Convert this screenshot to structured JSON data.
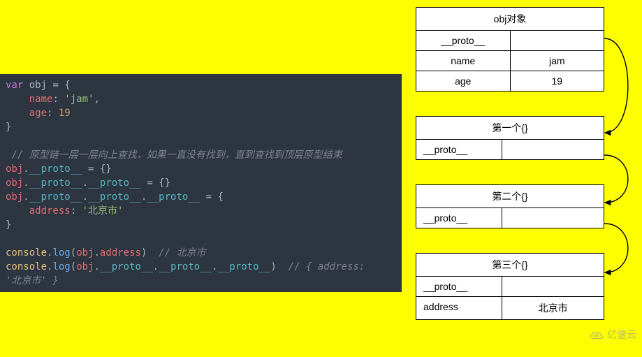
{
  "code": {
    "l1_kw": "var",
    "l1_var": " obj ",
    "l1_op": "= {",
    "l2_prop": "name",
    "l2_colon": ": ",
    "l2_val": "'jam'",
    "l2_comma": ",",
    "l3_prop": "age",
    "l3_colon": ": ",
    "l3_val": "19",
    "l4": "}",
    "l6_comment": "// 原型链一层一层向上查找，如果一直没有找到，直到查找到顶层原型结束",
    "l7_obj": "obj",
    "l7_dot": ".",
    "l7_proto": "__proto__",
    "l7_rest": " = {}",
    "l8_obj": "obj",
    "l8_d1": ".",
    "l8_p1": "__proto__",
    "l8_d2": ".",
    "l8_p2": "__proto__",
    "l8_rest": " = {}",
    "l9_obj": "obj",
    "l9_d1": ".",
    "l9_p1": "__proto__",
    "l9_d2": ".",
    "l9_p2": "__proto__",
    "l9_d3": ".",
    "l9_p3": "__proto__",
    "l9_rest": " = {",
    "l10_prop": "address",
    "l10_colon": ": ",
    "l10_val": "'北京市'",
    "l11": "}",
    "l13_console": "console",
    "l13_dot": ".",
    "l13_log": "log",
    "l13_open": "(",
    "l13_obj": "obj",
    "l13_d": ".",
    "l13_addr": "address",
    "l13_close": ")  ",
    "l13_comment": "// 北京市",
    "l14_console": "console",
    "l14_dot": ".",
    "l14_log": "log",
    "l14_open": "(",
    "l14_obj": "obj",
    "l14_d1": ".",
    "l14_p1": "__proto__",
    "l14_d2": ".",
    "l14_p2": "__proto__",
    "l14_d3": ".",
    "l14_p3": "__proto__",
    "l14_close": ")  ",
    "l14_comment": "// { address: ",
    "l15_comment": "'北京市' }"
  },
  "diagram": {
    "obj": {
      "title": "obj对象",
      "rows": [
        [
          "__proto__",
          ""
        ],
        [
          "name",
          "jam"
        ],
        [
          "age",
          "19"
        ]
      ]
    },
    "first": {
      "title": "第一个{}",
      "rows": [
        [
          "__proto__",
          ""
        ]
      ]
    },
    "second": {
      "title": "第二个{}",
      "rows": [
        [
          "__proto__",
          ""
        ]
      ]
    },
    "third": {
      "title": "第三个{}",
      "rows": [
        [
          "__proto__",
          ""
        ],
        [
          "address",
          "北京市"
        ]
      ]
    }
  },
  "watermark": "亿速云"
}
